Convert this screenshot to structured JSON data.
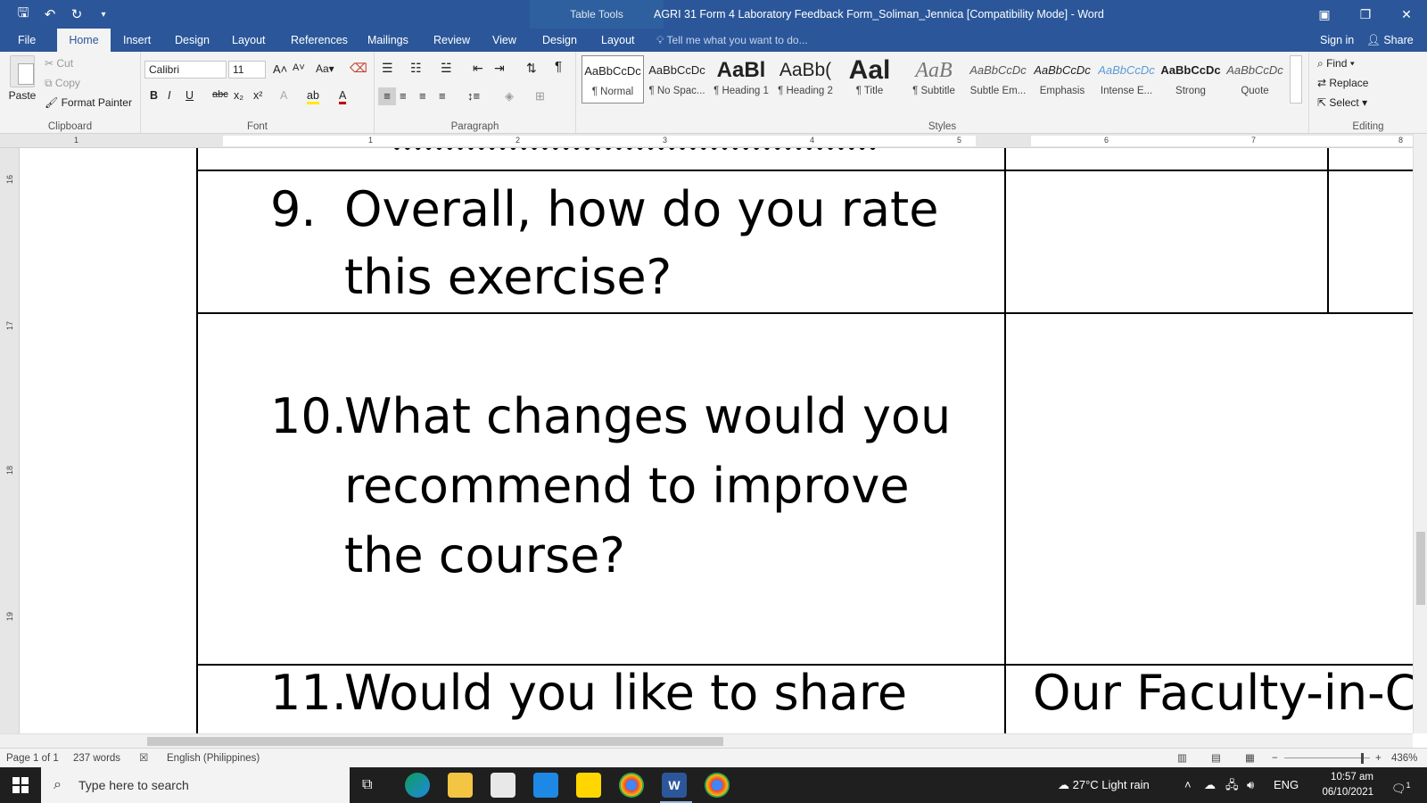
{
  "window": {
    "title": "AGRI 31 Form 4  Laboratory Feedback Form_Soliman_Jennica [Compatibility Mode] - Word",
    "context_label": "Table Tools",
    "controls": [
      "▣",
      "❐",
      "✕"
    ]
  },
  "tabs": [
    {
      "label": "File"
    },
    {
      "label": "Home"
    },
    {
      "label": "Insert"
    },
    {
      "label": "Design"
    },
    {
      "label": "Layout"
    },
    {
      "label": "References"
    },
    {
      "label": "Mailings"
    },
    {
      "label": "Review"
    },
    {
      "label": "View"
    },
    {
      "label": "Design"
    },
    {
      "label": "Layout"
    }
  ],
  "tellme": "Tell me what you want to do...",
  "signin": "Sign in",
  "share": "Share",
  "clipboard": {
    "label": "Clipboard",
    "paste": "Paste",
    "cut": "Cut",
    "copy": "Copy",
    "format_painter": "Format Painter"
  },
  "font": {
    "label": "Font",
    "family": "Calibri",
    "size": "11"
  },
  "paragraph": {
    "label": "Paragraph"
  },
  "styles": {
    "label": "Styles",
    "items": [
      {
        "preview": "AaBbCcDc",
        "name": "¶ Normal"
      },
      {
        "preview": "AaBbCcDc",
        "name": "¶ No Spac..."
      },
      {
        "preview": "AaBl",
        "name": "¶ Heading 1"
      },
      {
        "preview": "AaBb(",
        "name": "¶ Heading 2"
      },
      {
        "preview": "Aal",
        "name": "¶ Title"
      },
      {
        "preview": "AaB",
        "name": "¶ Subtitle"
      },
      {
        "preview": "AaBbCcDc",
        "name": "Subtle Em..."
      },
      {
        "preview": "AaBbCcDc",
        "name": "Emphasis"
      },
      {
        "preview": "AaBbCcDc",
        "name": "Intense E..."
      },
      {
        "preview": "AaBbCcDc",
        "name": "Strong"
      },
      {
        "preview": "AaBbCcDc",
        "name": "Quote"
      }
    ]
  },
  "editing": {
    "label": "Editing",
    "find": "Find",
    "replace": "Replace",
    "select": "Select"
  },
  "ruler_numbers": [
    "1",
    "1",
    "2",
    "3",
    "4",
    "5",
    "6",
    "7",
    "8"
  ],
  "vruler_numbers": [
    "16",
    "17",
    "18",
    "19"
  ],
  "document": {
    "q9": {
      "num": "9.",
      "line1": "Overall, how do you rate",
      "line2": "this exercise?"
    },
    "q10": {
      "num": "10.",
      "line1": "What changes would you",
      "line2": "recommend to improve",
      "line3": "the course?"
    },
    "q11": {
      "num": "11.",
      "line1": "Would you like to share"
    },
    "side_text": "Our  Faculty-in-C"
  },
  "status": {
    "page": "Page 1 of 1",
    "words": "237 words",
    "language": "English (Philippines)",
    "zoom": "436%"
  },
  "taskbar": {
    "search_placeholder": "Type here to search",
    "weather": "27°C  Light rain",
    "lang": "ENG",
    "time": "10:57 am",
    "date": "06/10/2021",
    "notifications": "1"
  },
  "colors": {
    "word_blue": "#2b579a",
    "taskbar": "#1f1f1f"
  }
}
